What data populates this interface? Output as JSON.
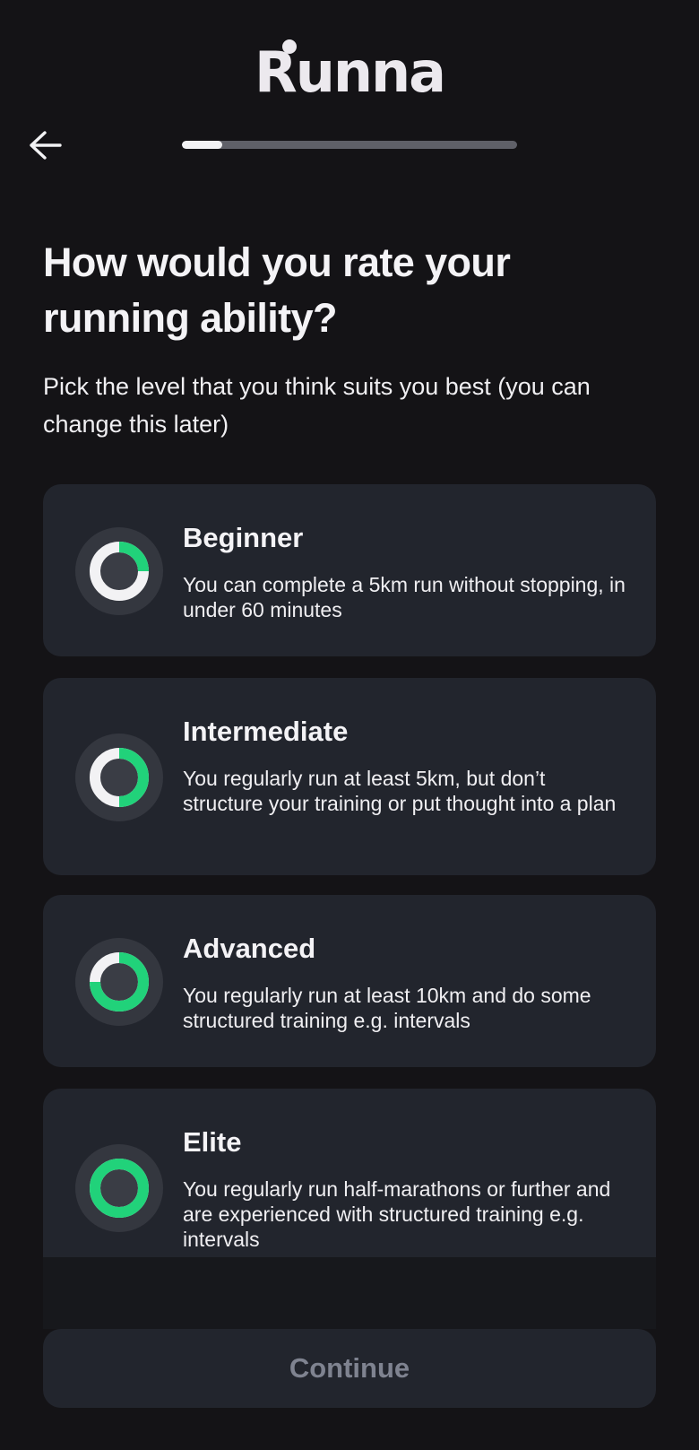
{
  "app": {
    "logo_text": "Runna"
  },
  "header": {
    "back_icon": "arrow-left-icon",
    "progress": 0.12
  },
  "question": {
    "title": "How would you rate your running ability?",
    "subtitle": "Pick the level that you think suits you best (you can change this later)"
  },
  "options": [
    {
      "title": "Beginner",
      "description": "You can complete a 5km run without stopping, in under 60 minutes",
      "level": 0.25
    },
    {
      "title": "Intermediate",
      "description": "You regularly run at least 5km, but don’t structure your training or put thought into a plan",
      "level": 0.5
    },
    {
      "title": "Advanced",
      "description": "You regularly run at least 10km and do some structured training e.g. intervals",
      "level": 0.75
    },
    {
      "title": "Elite",
      "description": "You regularly run half-marathons or further and are experienced with structured training e.g. intervals",
      "level": 1.0
    }
  ],
  "footer": {
    "continue_label": "Continue"
  },
  "colors": {
    "accent": "#21d27a",
    "ring_base": "#f2f2f4",
    "card": "#22252d",
    "background": "#141316"
  }
}
